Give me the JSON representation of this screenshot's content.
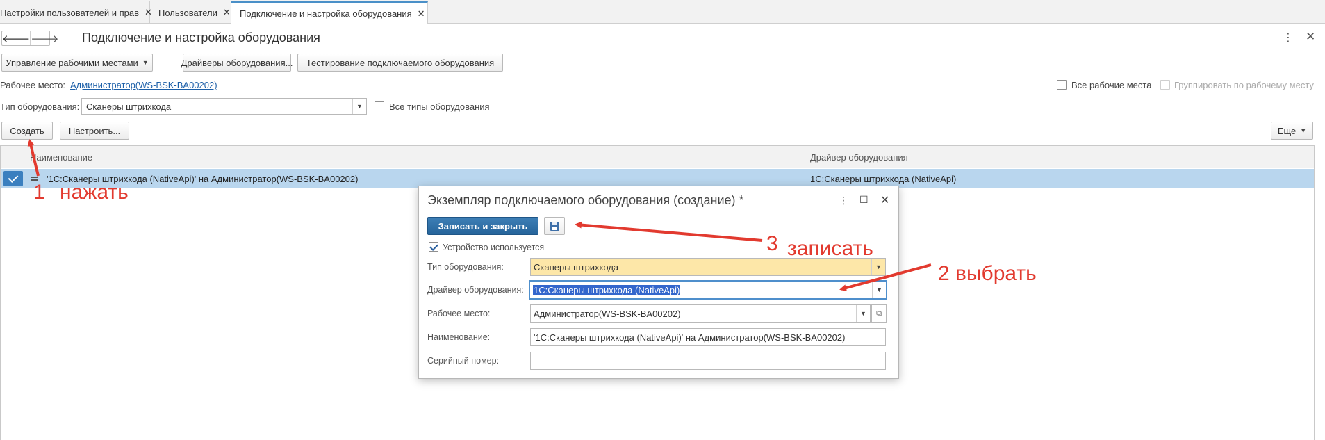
{
  "tabs": [
    {
      "label": "Настройки пользователей и прав"
    },
    {
      "label": "Пользователи"
    },
    {
      "label": "Подключение и настройка оборудования"
    }
  ],
  "header": {
    "title": "Подключение и настройка оборудования"
  },
  "toolbar": {
    "workplaces_label": "Управление рабочими местами",
    "drivers_label": "Драйверы оборудования...",
    "testing_label": "Тестирование подключаемого оборудования"
  },
  "filters": {
    "workplace_label": "Рабочее место:",
    "workplace_value": "Администратор(WS-BSK-BA00202)",
    "all_workplaces_label": "Все рабочие места",
    "group_by_workplace_label": "Группировать по рабочему месту",
    "equipment_type_label": "Тип оборудования:",
    "equipment_type_value": "Сканеры штрихкода",
    "all_types_label": "Все типы оборудования"
  },
  "actions": {
    "create_label": "Создать",
    "configure_label": "Настроить...",
    "more_label": "Еще"
  },
  "table": {
    "columns": [
      "Наименование",
      "Драйвер оборудования"
    ],
    "rows": [
      {
        "name": "'1С:Сканеры штрихкода (NativeApi)' на Администратор(WS-BSK-BA00202)",
        "driver": "1С:Сканеры штрихкода (NativeApi)",
        "checked": true
      }
    ]
  },
  "dialog": {
    "title": "Экземпляр подключаемого оборудования (создание) *",
    "save_close_label": "Записать и закрыть",
    "device_used_label": "Устройство используется",
    "device_used_checked": true,
    "fields": {
      "type_label": "Тип оборудования:",
      "type_value": "Сканеры штрихкода",
      "driver_label": "Драйвер оборудования:",
      "driver_value": "1С:Сканеры штрихкода (NativeApi)",
      "workplace_label": "Рабочее место:",
      "workplace_value": "Администратор(WS-BSK-BA00202)",
      "name_label": "Наименование:",
      "name_value": "'1С:Сканеры штрихкода (NativeApi)' на Администратор(WS-BSK-BA00202)",
      "serial_label": "Серийный номер:",
      "serial_value": ""
    }
  },
  "annotations": {
    "step1_number": "1",
    "step1_text": "нажать",
    "step2_text": "2 выбрать",
    "step3_number": "3",
    "step3_text": "записать"
  },
  "colors": {
    "accent": "#3a7fbf",
    "selected_row": "#b9d6ee",
    "required_field": "#fde7a8",
    "annotation": "#e23a2f"
  }
}
